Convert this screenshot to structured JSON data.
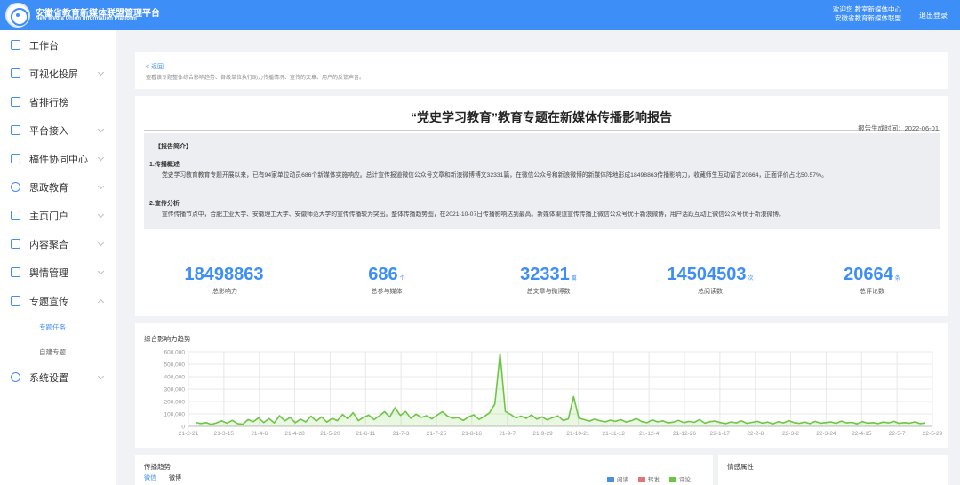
{
  "header": {
    "brand_cn": "安徽省教育新媒体联盟管理平台",
    "brand_en": "New Media Union Information Platform",
    "welcome_line1": "欢迎您 教室新媒体中心",
    "welcome_line2": "安徽省教育新媒体联盟",
    "logout": "退出登录"
  },
  "sidebar": {
    "items": [
      {
        "label": "工作台",
        "icon": "dashboard-icon"
      },
      {
        "label": "可视化投屏",
        "icon": "screen-icon"
      },
      {
        "label": "省排行榜",
        "icon": "ranking-icon"
      },
      {
        "label": "平台接入",
        "icon": "network-icon"
      },
      {
        "label": "稿件协同中心",
        "icon": "document-icon"
      },
      {
        "label": "思政教育",
        "icon": "pie-icon"
      },
      {
        "label": "主页门户",
        "icon": "portal-icon"
      },
      {
        "label": "内容聚合",
        "icon": "aggregate-icon"
      },
      {
        "label": "舆情管理",
        "icon": "opinion-icon"
      },
      {
        "label": "专题宣传",
        "icon": "topic-icon"
      },
      {
        "label": "系统设置",
        "icon": "settings-icon"
      }
    ],
    "sub_items": [
      {
        "label": "专题任务"
      },
      {
        "label": "自建专题"
      }
    ]
  },
  "intro": {
    "back": "< 返回",
    "description": "查看该专题整体综合影响趋势、各级单位执行助力传播情况、宣传的文章、用户的反馈声音。"
  },
  "report": {
    "title": "“党史学习教育”教育专题在新媒体传播影响报告",
    "date": "报告生成时间：2022-06-01",
    "summary_heading": "【报告简介】",
    "sec1_title": "1.传播概述",
    "sec1_text": "党史学习教育教育专题开展以来，已有94家单位动员686个新媒体实施响应。总计宣传报道微信公众号文章和新浪微博博文32331篇，在微信公众号和新浪微博的新媒体阵地形成18498863传播影响力，收藏师生互动留言20664，正面评价占比50.57%。",
    "sec2_title": "2.宣传分析",
    "sec2_text": "宣传传播节点中，合肥工业大学、安徽理工大学、安徽师范大学的宣传传播较为突出。整体传播趋势图，在2021-10-07日传播影响达到最高。新媒体渠道宣传传播上微信公众号优于新浪微博，用户活跃互动上微信公众号优于新浪微博。"
  },
  "stats": [
    {
      "value": "18498863",
      "unit": "",
      "label": "总影响力"
    },
    {
      "value": "686",
      "unit": "个",
      "label": "总参与媒体"
    },
    {
      "value": "32331",
      "unit": "篇",
      "label": "总文章与微博数"
    },
    {
      "value": "14504503",
      "unit": "次",
      "label": "总阅读数"
    },
    {
      "value": "20664",
      "unit": "条",
      "label": "总评论数"
    }
  ],
  "trend": {
    "title": "综合影响力趋势"
  },
  "chart_data": {
    "type": "area",
    "title": "综合影响力趋势",
    "color": "#6cc644",
    "ylim": [
      0,
      600000
    ],
    "y_ticks": [
      "0",
      "100,000",
      "200,000",
      "300,000",
      "400,000",
      "500,000",
      "600,000"
    ],
    "x_ticks": [
      "21-2-21",
      "21-3-15",
      "21-4-6",
      "21-4-28",
      "21-5-20",
      "21-6-11",
      "21-7-3",
      "21-7-25",
      "21-8-16",
      "21-9-7",
      "21-9-29",
      "21-10-21",
      "21-11-12",
      "21-12-4",
      "21-12-26",
      "22-1-17",
      "22-2-8",
      "22-3-2",
      "22-3-24",
      "22-4-15",
      "22-5-7",
      "22-5-29"
    ],
    "values": [
      32000,
      22000,
      30000,
      16000,
      28000,
      44000,
      26000,
      48000,
      22000,
      18000,
      54000,
      38000,
      68000,
      30000,
      62000,
      28000,
      86000,
      44000,
      72000,
      30000,
      58000,
      36000,
      82000,
      42000,
      76000,
      34000,
      64000,
      46000,
      96000,
      60000,
      110000,
      46000,
      72000,
      90000,
      54000,
      84000,
      118000,
      76000,
      150000,
      88000,
      120000,
      64000,
      98000,
      72000,
      86000,
      60000,
      90000,
      118000,
      82000,
      66000,
      70000,
      48000,
      76000,
      92000,
      56000,
      80000,
      110000,
      180000,
      585000,
      120000,
      96000,
      68000,
      82000,
      64000,
      92000,
      58000,
      76000,
      52000,
      70000,
      84000,
      48000,
      60000,
      240000,
      66000,
      54000,
      42000,
      58000,
      46000,
      36000,
      50000,
      40000,
      54000,
      34000,
      46000,
      62000,
      38000,
      30000,
      52000,
      36000,
      44000,
      28000,
      34000,
      48000,
      30000,
      40000,
      32000,
      54000,
      26000,
      38000,
      42000,
      30000,
      22000,
      36000,
      28000,
      44000,
      24000,
      32000,
      40000,
      26000,
      34000,
      20000,
      38000,
      28000,
      46000,
      30000,
      24000,
      34000,
      22000,
      40000,
      26000,
      30000,
      36000,
      24000,
      42000,
      28000,
      32000,
      20000,
      38000,
      26000,
      30000,
      22000,
      34000,
      28000,
      40000,
      24000,
      30000,
      26000,
      36000,
      22000,
      28000
    ]
  },
  "trend_panel": {
    "title": "传播趋势",
    "tabs": [
      "微信",
      "微博"
    ],
    "legend": [
      {
        "label": "阅读",
        "color": "#4a90e2"
      },
      {
        "label": "转发",
        "color": "#e57373"
      },
      {
        "label": "评论",
        "color": "#6cc644"
      }
    ]
  },
  "sentiment_panel": {
    "title": "情感属性"
  }
}
